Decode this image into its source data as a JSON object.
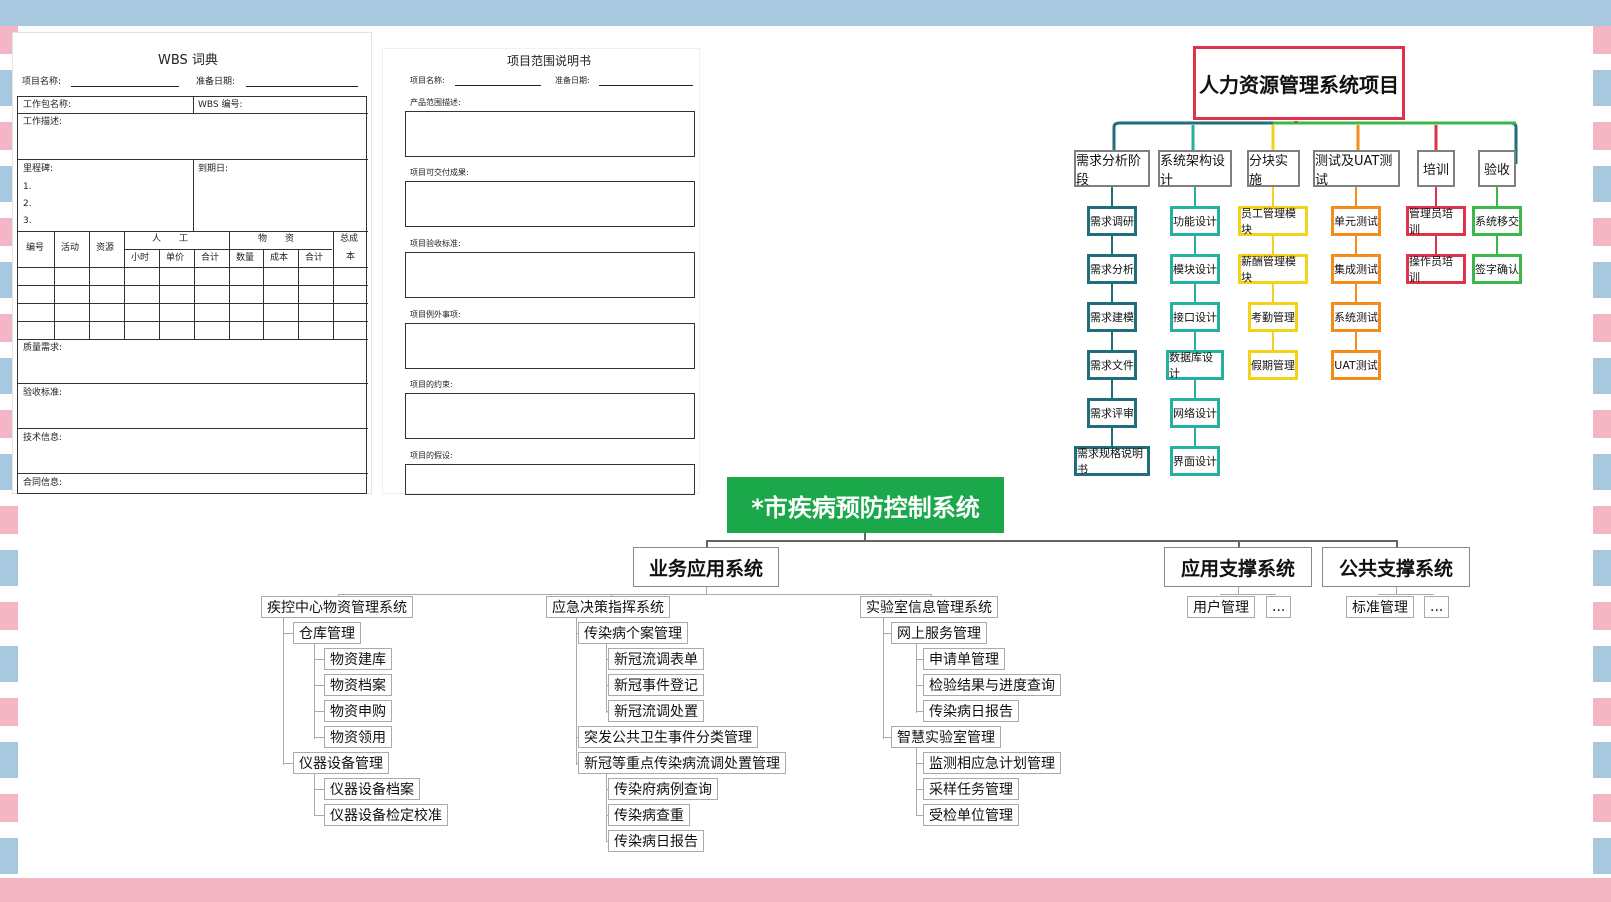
{
  "wbs": {
    "title": "WBS 词典",
    "project_name_label": "项目名称:",
    "prepare_date_label": "准备日期:",
    "work_package_label": "工作包名称:",
    "wbs_no_label": "WBS 编号:",
    "work_desc_label": "工作描述:",
    "milestone_label": "里程碑:",
    "due_date_label": "到期日:",
    "milestone_items": [
      "1.",
      "2.",
      "3."
    ],
    "col_no": "编号",
    "col_activity": "活动",
    "col_resource": "资源",
    "col_labor": "人　　工",
    "col_material": "物　　资",
    "col_total": "总成",
    "col_total2": "本",
    "sub_hours": "小时",
    "sub_price": "单价",
    "sub_sum1": "合计",
    "sub_qty": "数量",
    "sub_cost": "成本",
    "sub_sum2": "合计",
    "quality_label": "质量需求:",
    "acceptance_label": "验收标准:",
    "tech_label": "技术信息:",
    "contract_label": "合同信息:"
  },
  "scope": {
    "title": "项目范围说明书",
    "project_name_label": "项目名称:",
    "prepare_date_label": "准备日期:",
    "sections": [
      "产品范围描述:",
      "项目可交付成果:",
      "项目验收标准:",
      "项目例外事项:",
      "项目的约束:",
      "项目的假设:"
    ]
  },
  "hr": {
    "root": "人力资源管理系统项目",
    "phases": [
      {
        "name": "需求分析阶段",
        "color": "#1f6e7a",
        "items": [
          "需求调研",
          "需求分析",
          "需求建模",
          "需求文件",
          "需求评审",
          "需求规格说明书"
        ]
      },
      {
        "name": "系统架构设计",
        "color": "#26b0a0",
        "items": [
          "功能设计",
          "模块设计",
          "接口设计",
          "数据库设计",
          "网络设计",
          "界面设计"
        ]
      },
      {
        "name": "分块实施",
        "color": "#f2d21b",
        "items": [
          "员工管理模块",
          "薪酬管理模块",
          "考勤管理",
          "假期管理"
        ]
      },
      {
        "name": "测试及UAT测试",
        "color": "#f28c1b",
        "items": [
          "单元测试",
          "集成测试",
          "系统测试",
          "UAT测试"
        ]
      },
      {
        "name": "培训",
        "color": "#e0324b",
        "items": [
          "管理员培训",
          "操作员培训"
        ]
      },
      {
        "name": "验收",
        "color": "#3cb84a",
        "items": [
          "系统移交",
          "签字确认"
        ]
      }
    ]
  },
  "disease": {
    "root": "*市疾病预防控制系统",
    "l1": [
      "业务应用系统",
      "应用支撑系统",
      "公共支撑系统"
    ],
    "b1": {
      "name": "疾控中心物资管理系统",
      "g1": "仓库管理",
      "g1_items": [
        "物资建库",
        "物资档案",
        "物资申购",
        "物资领用"
      ],
      "g2": "仪器设备管理",
      "g2_items": [
        "仪器设备档案",
        "仪器设备检定校准"
      ]
    },
    "b2": {
      "name": "应急决策指挥系统",
      "g1": "传染病个案管理",
      "g1_items": [
        "新冠流调表单",
        "新冠事件登记",
        "新冠流调处置"
      ],
      "g2": "突发公共卫生事件分类管理",
      "g3": "新冠等重点传染病流调处置管理",
      "g3_items": [
        "传染府病例查询",
        "传染病查重",
        "传染病日报告"
      ]
    },
    "b3": {
      "name": "实验室信息管理系统",
      "g1": "网上服务管理",
      "g1_items": [
        "申请单管理",
        "检验结果与进度查询",
        "传染病日报告"
      ],
      "g2": "智慧实验室管理",
      "g2_items": [
        "监测相应急计划管理",
        "采样任务管理",
        "受检单位管理"
      ]
    },
    "support": [
      "用户管理",
      "..."
    ],
    "public": [
      "标准管理",
      "..."
    ]
  }
}
